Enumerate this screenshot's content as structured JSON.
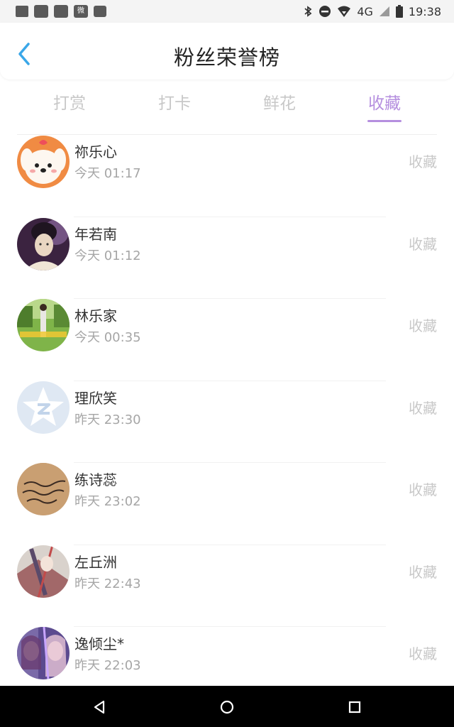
{
  "status_bar": {
    "left_icons": [
      "message-icon",
      "app-icon",
      "app-icon",
      "weibo-icon",
      "image-icon"
    ],
    "weibo_text": "微",
    "network": "4G",
    "time": "19:38"
  },
  "header": {
    "title": "粉丝荣誉榜"
  },
  "tabs": [
    {
      "label": "打赏",
      "active": false
    },
    {
      "label": "打卡",
      "active": false
    },
    {
      "label": "鲜花",
      "active": false
    },
    {
      "label": "收藏",
      "active": true
    }
  ],
  "colors": {
    "accent": "#b58fdf",
    "inactive_tab": "#c8c8c8",
    "back_arrow": "#3aa7e8"
  },
  "fans": [
    {
      "name": "祢乐心",
      "time": "今天 01:17",
      "action": "收藏",
      "avatar": "cartoon-dog-avatar"
    },
    {
      "name": "年若南",
      "time": "今天 01:12",
      "action": "收藏",
      "avatar": "portrait-woman-avatar"
    },
    {
      "name": "林乐家",
      "time": "今天 00:35",
      "action": "收藏",
      "avatar": "outdoor-photo-avatar"
    },
    {
      "name": "理欣笑",
      "time": "昨天 23:30",
      "action": "收藏",
      "avatar": "qq-default-avatar"
    },
    {
      "name": "练诗蕊",
      "time": "昨天 23:02",
      "action": "收藏",
      "avatar": "handwriting-avatar"
    },
    {
      "name": "左丘洲",
      "time": "昨天 22:43",
      "action": "收藏",
      "avatar": "anime-art-avatar"
    },
    {
      "name": "逸倾尘*",
      "time": "昨天 22:03",
      "action": "收藏",
      "avatar": "anime-girl-avatar"
    }
  ],
  "nav": [
    "back-nav-icon",
    "home-nav-icon",
    "recents-nav-icon"
  ]
}
